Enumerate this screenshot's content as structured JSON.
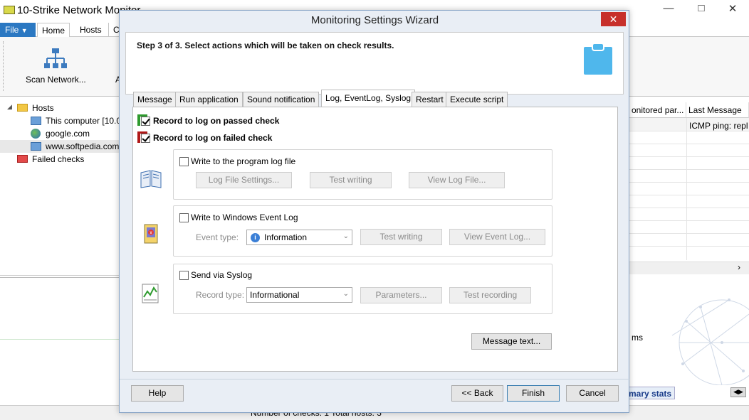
{
  "app": {
    "title": "10-Strike Network Monitor",
    "ribbon_tabs": [
      "File",
      "Home",
      "Hosts",
      "C"
    ],
    "scan_label": "Scan Network...",
    "ribbon_a": "A",
    "tree": {
      "hosts": "Hosts",
      "items": [
        "This computer [10.0",
        "google.com",
        "www.softpedia.com"
      ],
      "failed": "Failed checks"
    },
    "grid": {
      "col1": "onitored par...",
      "col2": "Last Message",
      "cell": "ICMP ping: repl"
    },
    "ms_text": "ms",
    "summary_tab": "mary stats",
    "status": "Number of checks: 1   Total hosts: 3"
  },
  "dialog": {
    "title": "Monitoring Settings Wizard",
    "close": "✕",
    "step_text": "Step 3 of 3. Select actions which will be taken on check results.",
    "tabs": [
      "Message",
      "Run application",
      "Sound notification",
      "Log, EventLog, Syslog",
      "Restart",
      "Execute script"
    ],
    "active_tab": "Log, EventLog, Syslog",
    "record_passed": "Record to log on passed check",
    "record_failed": "Record to log on failed check",
    "passed_checked": true,
    "failed_checked": true,
    "passed_color": "#2e9a2e",
    "failed_color": "#b01818",
    "program_log": {
      "label": "Write to the program log file",
      "buttons": [
        "Log File Settings...",
        "Test writing",
        "View Log File..."
      ]
    },
    "event_log": {
      "label": "Write to Windows Event Log",
      "type_label": "Event type:",
      "type_value": "Information",
      "buttons": [
        "Test writing",
        "View Event Log..."
      ]
    },
    "syslog": {
      "label": "Send via Syslog",
      "type_label": "Record type:",
      "type_value": "Informational",
      "buttons": [
        "Parameters...",
        "Test recording"
      ]
    },
    "message_text_btn": "Message text...",
    "footer": {
      "help": "Help",
      "back": "<< Back",
      "finish": "Finish",
      "cancel": "Cancel"
    }
  }
}
